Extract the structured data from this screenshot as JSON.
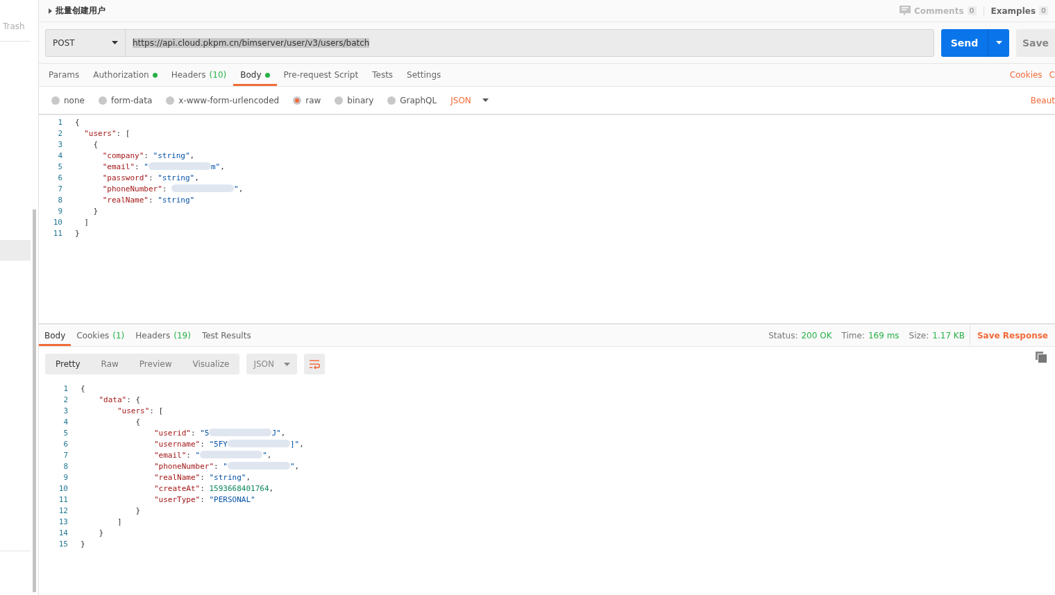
{
  "sidebar": {
    "items": [
      {
        "label": "Trash"
      }
    ]
  },
  "request": {
    "title": "批量创建用户",
    "comments": {
      "label": "Comments",
      "count": "0"
    },
    "examples": {
      "label": "Examples",
      "count": "0"
    },
    "method": "POST",
    "url": "https://api.cloud.pkpm.cn/bimserver/user/v3/users/batch",
    "send": "Send",
    "save": "Save",
    "tabs": [
      {
        "label": "Params",
        "dot": false,
        "selected": false
      },
      {
        "label": "Authorization",
        "dot": true,
        "selected": false
      },
      {
        "label": "Headers",
        "count": "(10)",
        "dot": false,
        "selected": false
      },
      {
        "label": "Body",
        "dot": true,
        "selected": true
      },
      {
        "label": "Pre-request Script",
        "dot": false,
        "selected": false
      },
      {
        "label": "Tests",
        "dot": false,
        "selected": false
      },
      {
        "label": "Settings",
        "dot": false,
        "selected": false
      }
    ],
    "cookies_link": "Cookies",
    "cookies_link_2": "C",
    "body_types": [
      {
        "label": "none",
        "selected": false
      },
      {
        "label": "form-data",
        "selected": false
      },
      {
        "label": "x-www-form-urlencoded",
        "selected": false
      },
      {
        "label": "raw",
        "selected": true
      },
      {
        "label": "binary",
        "selected": false
      },
      {
        "label": "GraphQL",
        "selected": false
      }
    ],
    "format": "JSON",
    "beautify": "Beaut",
    "line_numbers": [
      "1",
      "2",
      "3",
      "4",
      "5",
      "6",
      "7",
      "8",
      "9",
      "10",
      "11"
    ],
    "code": [
      [
        {
          "kind": "punct",
          "text": "{"
        }
      ],
      [
        {
          "kind": "key",
          "text": "  \"users\""
        },
        {
          "kind": "punct",
          "text": ": ["
        }
      ],
      [
        {
          "kind": "punct",
          "text": "    {"
        }
      ],
      [
        {
          "kind": "key",
          "text": "      \"company\""
        },
        {
          "kind": "punct",
          "text": ": "
        },
        {
          "kind": "string",
          "text": "\"string\""
        },
        {
          "kind": "punct",
          "text": ","
        }
      ],
      [
        {
          "kind": "key",
          "text": "      \"email\""
        },
        {
          "kind": "punct",
          "text": ": "
        },
        {
          "kind": "string",
          "text": "\""
        },
        {
          "kind": "redacted"
        },
        {
          "kind": "string",
          "text": "m\""
        },
        {
          "kind": "punct",
          "text": ","
        }
      ],
      [
        {
          "kind": "key",
          "text": "      \"password\""
        },
        {
          "kind": "punct",
          "text": ": "
        },
        {
          "kind": "string",
          "text": "\"string\""
        },
        {
          "kind": "punct",
          "text": ","
        }
      ],
      [
        {
          "kind": "key",
          "text": "      \"phoneNumber\""
        },
        {
          "kind": "punct",
          "text": ": "
        },
        {
          "kind": "redacted"
        },
        {
          "kind": "string",
          "text": "\""
        },
        {
          "kind": "punct",
          "text": ","
        }
      ],
      [
        {
          "kind": "key",
          "text": "      \"realName\""
        },
        {
          "kind": "punct",
          "text": ": "
        },
        {
          "kind": "string",
          "text": "\"string\""
        }
      ],
      [
        {
          "kind": "punct",
          "text": "    }"
        }
      ],
      [
        {
          "kind": "punct",
          "text": "  ]"
        }
      ],
      [
        {
          "kind": "punct",
          "text": "}"
        }
      ]
    ]
  },
  "response": {
    "tabs": [
      {
        "label": "Body",
        "selected": true
      },
      {
        "label": "Cookies",
        "count": "(1)",
        "selected": false
      },
      {
        "label": "Headers",
        "count": "(19)",
        "selected": false
      },
      {
        "label": "Test Results",
        "selected": false
      }
    ],
    "status": {
      "label": "Status:",
      "value": "200 OK"
    },
    "time": {
      "label": "Time:",
      "value": "169 ms"
    },
    "size": {
      "label": "Size:",
      "value": "1.17 KB"
    },
    "save": "Save Response",
    "views": [
      {
        "label": "Pretty",
        "selected": true
      },
      {
        "label": "Raw",
        "selected": false
      },
      {
        "label": "Preview",
        "selected": false
      },
      {
        "label": "Visualize",
        "selected": false
      }
    ],
    "format": "JSON",
    "line_numbers": [
      "1",
      "2",
      "3",
      "4",
      "5",
      "6",
      "7",
      "8",
      "9",
      "10",
      "11",
      "12",
      "13",
      "14",
      "15"
    ],
    "code": [
      [
        {
          "kind": "punct",
          "text": "{"
        }
      ],
      [
        {
          "kind": "key",
          "text": "    \"data\""
        },
        {
          "kind": "punct",
          "text": ": {"
        }
      ],
      [
        {
          "kind": "key",
          "text": "        \"users\""
        },
        {
          "kind": "punct",
          "text": ": ["
        }
      ],
      [
        {
          "kind": "punct",
          "text": "            {"
        }
      ],
      [
        {
          "kind": "key",
          "text": "                \"userid\""
        },
        {
          "kind": "punct",
          "text": ": "
        },
        {
          "kind": "string",
          "text": "\"5"
        },
        {
          "kind": "redacted"
        },
        {
          "kind": "string",
          "text": "J\""
        },
        {
          "kind": "punct",
          "text": ","
        }
      ],
      [
        {
          "kind": "key",
          "text": "                \"username\""
        },
        {
          "kind": "punct",
          "text": ": "
        },
        {
          "kind": "string",
          "text": "\"5FY"
        },
        {
          "kind": "redacted"
        },
        {
          "kind": "string",
          "text": "]\""
        },
        {
          "kind": "punct",
          "text": ","
        }
      ],
      [
        {
          "kind": "key",
          "text": "                \"email\""
        },
        {
          "kind": "punct",
          "text": ": "
        },
        {
          "kind": "string",
          "text": "\""
        },
        {
          "kind": "redacted"
        },
        {
          "kind": "string",
          "text": "\""
        },
        {
          "kind": "punct",
          "text": ","
        }
      ],
      [
        {
          "kind": "key",
          "text": "                \"phoneNumber\""
        },
        {
          "kind": "punct",
          "text": ": "
        },
        {
          "kind": "string",
          "text": "\""
        },
        {
          "kind": "redacted"
        },
        {
          "kind": "string",
          "text": "\""
        },
        {
          "kind": "punct",
          "text": ","
        }
      ],
      [
        {
          "kind": "key",
          "text": "                \"realName\""
        },
        {
          "kind": "punct",
          "text": ": "
        },
        {
          "kind": "string",
          "text": "\"string\""
        },
        {
          "kind": "punct",
          "text": ","
        }
      ],
      [
        {
          "kind": "key",
          "text": "                \"createAt\""
        },
        {
          "kind": "punct",
          "text": ": "
        },
        {
          "kind": "number",
          "text": "1593668401764"
        },
        {
          "kind": "punct",
          "text": ","
        }
      ],
      [
        {
          "kind": "key",
          "text": "                \"userType\""
        },
        {
          "kind": "punct",
          "text": ": "
        },
        {
          "kind": "string",
          "text": "\"PERSONAL\""
        }
      ],
      [
        {
          "kind": "punct",
          "text": "            }"
        }
      ],
      [
        {
          "kind": "punct",
          "text": "        ]"
        }
      ],
      [
        {
          "kind": "punct",
          "text": "    }"
        }
      ],
      [
        {
          "kind": "punct",
          "text": "}"
        }
      ]
    ]
  }
}
